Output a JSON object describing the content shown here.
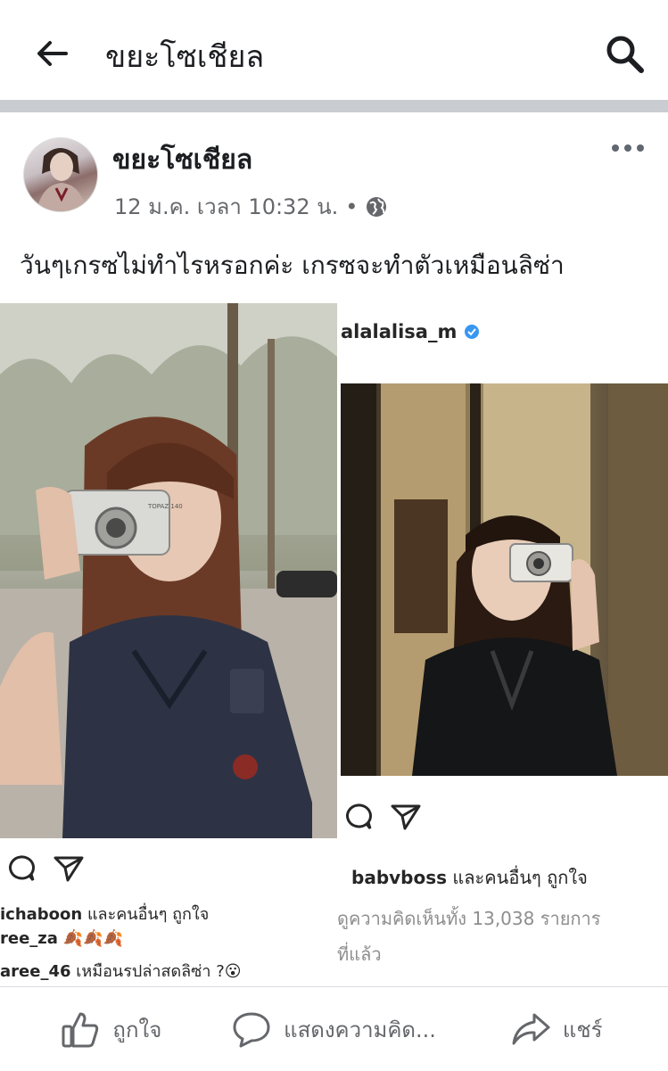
{
  "topbar": {
    "title": "ขยะโซเชียล"
  },
  "post": {
    "author": "ขยะโซเชียล",
    "timestamp": "12 ม.ค. เวลา 10:32 น.",
    "separator": "•",
    "text": "วันๆเกรซไม่ทำไรหรอกค่ะ เกรซจะทำตัวเหมือนลิซ่า",
    "left_ig": {
      "camera_text": "TOPAZ 140",
      "likes_user": "ichaboon",
      "likes_suffix": " และคนอื่นๆ ถูกใจ",
      "comment1_user": "ree_za",
      "comment1_text": " 🍂🍂🍂",
      "comment2_user": "aree_46",
      "comment2_text": " เหมือนรปล่าสดลิซ่า ?😮"
    },
    "right_ig": {
      "username": "alalalisa_m",
      "likes_user": "babvboss",
      "likes_suffix": " และคนอื่นๆ ถูกใจ",
      "comments_count": "ดูความคิดเห็นทั้ง 13,038 รายการ",
      "time_text": "ที่แล้ว"
    }
  },
  "actions": {
    "like": "ถูกใจ",
    "comment": "แสดงความคิด...",
    "share": "แชร์"
  },
  "colors": {
    "accent": "#1877f2",
    "verified": "#3897f0",
    "muted": "#65676b"
  }
}
